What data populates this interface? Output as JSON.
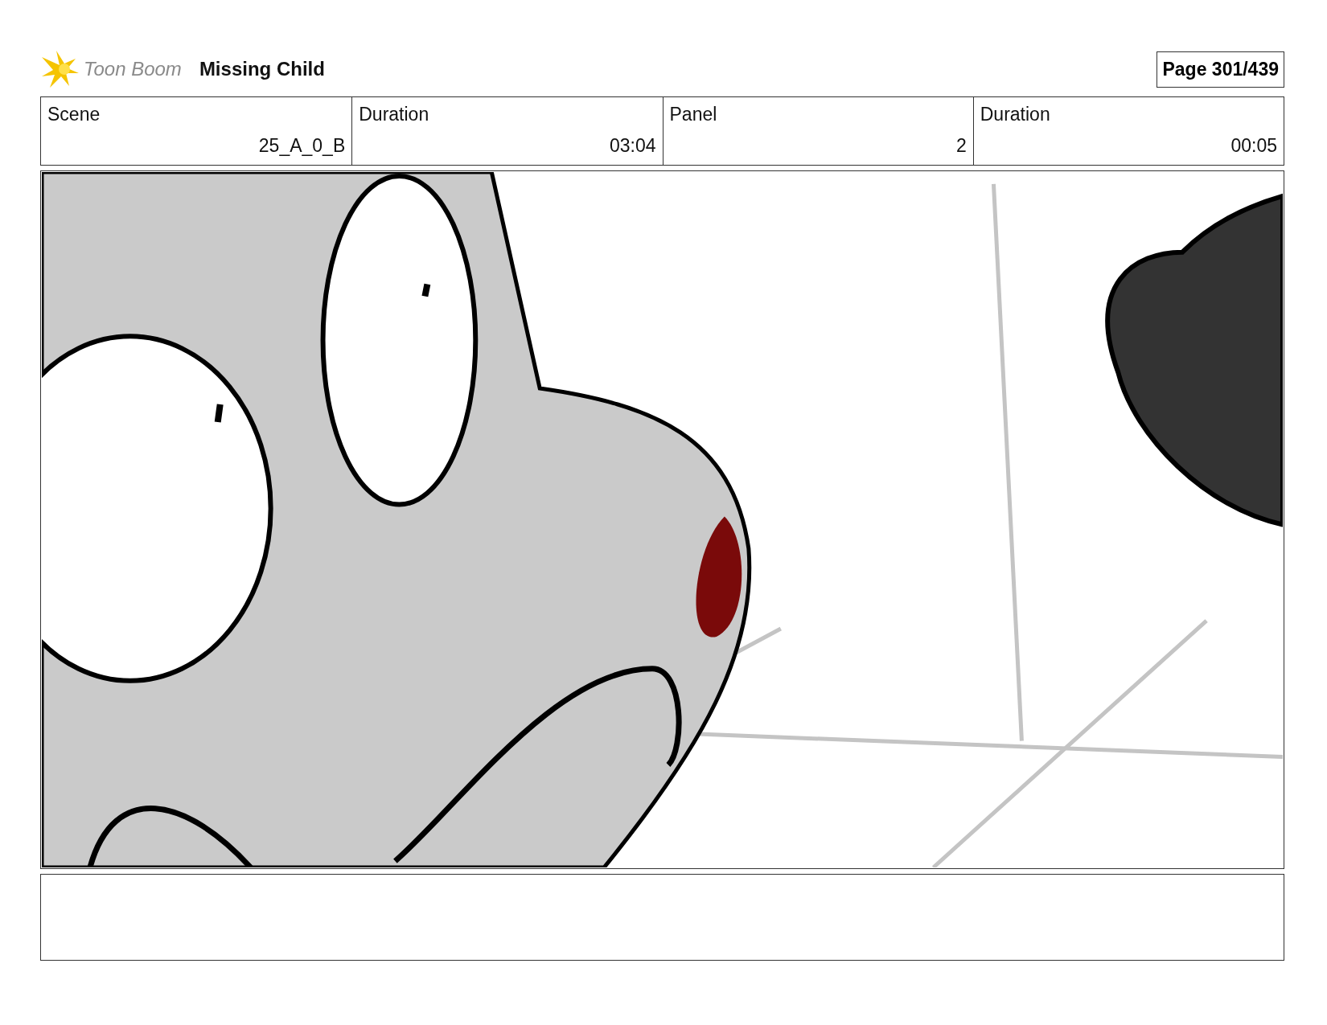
{
  "header": {
    "logo_text": "Toon Boom",
    "title": "Missing Child",
    "page": "Page 301/439"
  },
  "info_table": {
    "columns": [
      "Scene",
      "Duration",
      "Panel",
      "Duration"
    ],
    "row": [
      "25_A_0_B",
      "03:04",
      "2",
      "00:05"
    ]
  }
}
